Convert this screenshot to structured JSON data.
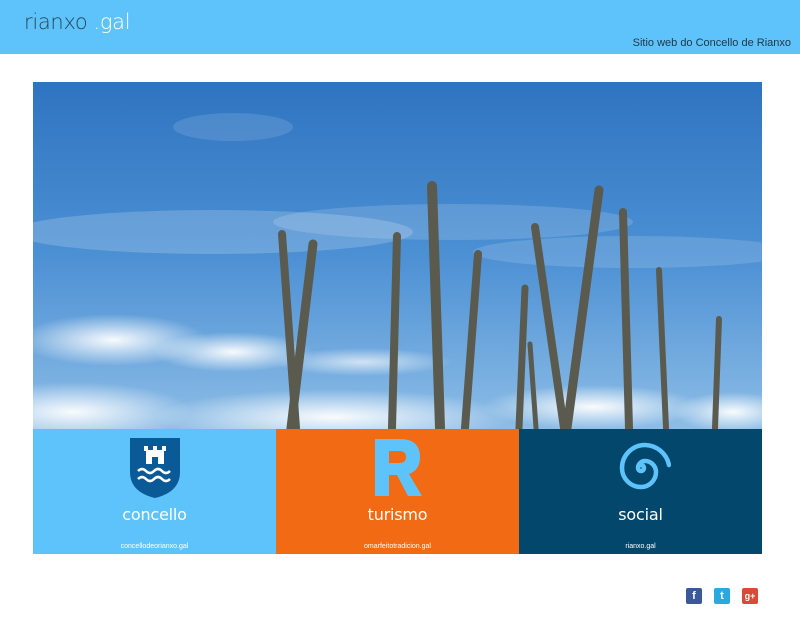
{
  "header": {
    "logo_main": "rianxo",
    "logo_suffix": ".gal",
    "tagline": "Sitio web do Concello de Rianxo"
  },
  "tiles": [
    {
      "name": "concello",
      "url": "concellodeorianxo.gal",
      "color": "#5fc3fb",
      "icon": "coat-of-arms-icon"
    },
    {
      "name": "turismo",
      "url": "omarfeitotradicion.gal",
      "color": "#f26a14",
      "icon": "letter-r-icon"
    },
    {
      "name": "social",
      "url": "rianxo.gal",
      "color": "#04476c",
      "icon": "spiral-icon"
    }
  ],
  "social": [
    {
      "name": "facebook",
      "glyph": "f",
      "icon": "facebook-icon"
    },
    {
      "name": "twitter",
      "glyph": "t",
      "icon": "twitter-icon"
    },
    {
      "name": "google-plus",
      "glyph": "g+",
      "icon": "google-plus-icon"
    }
  ]
}
